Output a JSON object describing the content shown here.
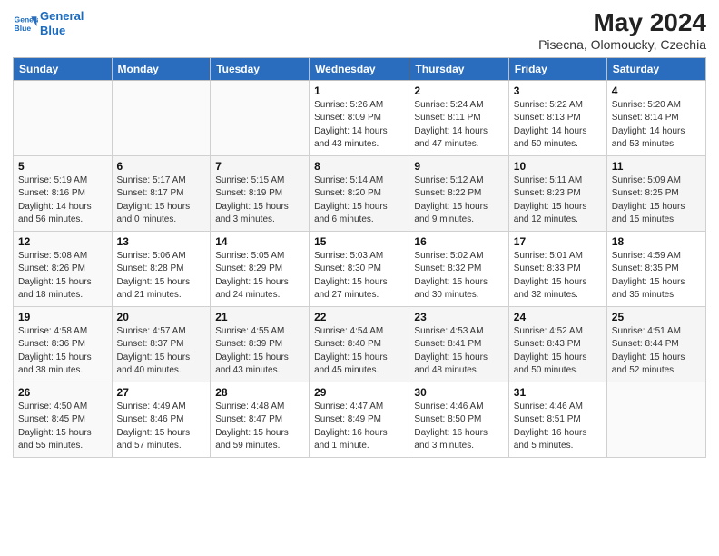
{
  "header": {
    "logo_line1": "General",
    "logo_line2": "Blue",
    "title": "May 2024",
    "subtitle": "Pisecna, Olomoucky, Czechia"
  },
  "days_of_week": [
    "Sunday",
    "Monday",
    "Tuesday",
    "Wednesday",
    "Thursday",
    "Friday",
    "Saturday"
  ],
  "weeks": [
    [
      {
        "day": "",
        "info": ""
      },
      {
        "day": "",
        "info": ""
      },
      {
        "day": "",
        "info": ""
      },
      {
        "day": "1",
        "info": "Sunrise: 5:26 AM\nSunset: 8:09 PM\nDaylight: 14 hours and 43 minutes."
      },
      {
        "day": "2",
        "info": "Sunrise: 5:24 AM\nSunset: 8:11 PM\nDaylight: 14 hours and 47 minutes."
      },
      {
        "day": "3",
        "info": "Sunrise: 5:22 AM\nSunset: 8:13 PM\nDaylight: 14 hours and 50 minutes."
      },
      {
        "day": "4",
        "info": "Sunrise: 5:20 AM\nSunset: 8:14 PM\nDaylight: 14 hours and 53 minutes."
      }
    ],
    [
      {
        "day": "5",
        "info": "Sunrise: 5:19 AM\nSunset: 8:16 PM\nDaylight: 14 hours and 56 minutes."
      },
      {
        "day": "6",
        "info": "Sunrise: 5:17 AM\nSunset: 8:17 PM\nDaylight: 15 hours and 0 minutes."
      },
      {
        "day": "7",
        "info": "Sunrise: 5:15 AM\nSunset: 8:19 PM\nDaylight: 15 hours and 3 minutes."
      },
      {
        "day": "8",
        "info": "Sunrise: 5:14 AM\nSunset: 8:20 PM\nDaylight: 15 hours and 6 minutes."
      },
      {
        "day": "9",
        "info": "Sunrise: 5:12 AM\nSunset: 8:22 PM\nDaylight: 15 hours and 9 minutes."
      },
      {
        "day": "10",
        "info": "Sunrise: 5:11 AM\nSunset: 8:23 PM\nDaylight: 15 hours and 12 minutes."
      },
      {
        "day": "11",
        "info": "Sunrise: 5:09 AM\nSunset: 8:25 PM\nDaylight: 15 hours and 15 minutes."
      }
    ],
    [
      {
        "day": "12",
        "info": "Sunrise: 5:08 AM\nSunset: 8:26 PM\nDaylight: 15 hours and 18 minutes."
      },
      {
        "day": "13",
        "info": "Sunrise: 5:06 AM\nSunset: 8:28 PM\nDaylight: 15 hours and 21 minutes."
      },
      {
        "day": "14",
        "info": "Sunrise: 5:05 AM\nSunset: 8:29 PM\nDaylight: 15 hours and 24 minutes."
      },
      {
        "day": "15",
        "info": "Sunrise: 5:03 AM\nSunset: 8:30 PM\nDaylight: 15 hours and 27 minutes."
      },
      {
        "day": "16",
        "info": "Sunrise: 5:02 AM\nSunset: 8:32 PM\nDaylight: 15 hours and 30 minutes."
      },
      {
        "day": "17",
        "info": "Sunrise: 5:01 AM\nSunset: 8:33 PM\nDaylight: 15 hours and 32 minutes."
      },
      {
        "day": "18",
        "info": "Sunrise: 4:59 AM\nSunset: 8:35 PM\nDaylight: 15 hours and 35 minutes."
      }
    ],
    [
      {
        "day": "19",
        "info": "Sunrise: 4:58 AM\nSunset: 8:36 PM\nDaylight: 15 hours and 38 minutes."
      },
      {
        "day": "20",
        "info": "Sunrise: 4:57 AM\nSunset: 8:37 PM\nDaylight: 15 hours and 40 minutes."
      },
      {
        "day": "21",
        "info": "Sunrise: 4:55 AM\nSunset: 8:39 PM\nDaylight: 15 hours and 43 minutes."
      },
      {
        "day": "22",
        "info": "Sunrise: 4:54 AM\nSunset: 8:40 PM\nDaylight: 15 hours and 45 minutes."
      },
      {
        "day": "23",
        "info": "Sunrise: 4:53 AM\nSunset: 8:41 PM\nDaylight: 15 hours and 48 minutes."
      },
      {
        "day": "24",
        "info": "Sunrise: 4:52 AM\nSunset: 8:43 PM\nDaylight: 15 hours and 50 minutes."
      },
      {
        "day": "25",
        "info": "Sunrise: 4:51 AM\nSunset: 8:44 PM\nDaylight: 15 hours and 52 minutes."
      }
    ],
    [
      {
        "day": "26",
        "info": "Sunrise: 4:50 AM\nSunset: 8:45 PM\nDaylight: 15 hours and 55 minutes."
      },
      {
        "day": "27",
        "info": "Sunrise: 4:49 AM\nSunset: 8:46 PM\nDaylight: 15 hours and 57 minutes."
      },
      {
        "day": "28",
        "info": "Sunrise: 4:48 AM\nSunset: 8:47 PM\nDaylight: 15 hours and 59 minutes."
      },
      {
        "day": "29",
        "info": "Sunrise: 4:47 AM\nSunset: 8:49 PM\nDaylight: 16 hours and 1 minute."
      },
      {
        "day": "30",
        "info": "Sunrise: 4:46 AM\nSunset: 8:50 PM\nDaylight: 16 hours and 3 minutes."
      },
      {
        "day": "31",
        "info": "Sunrise: 4:46 AM\nSunset: 8:51 PM\nDaylight: 16 hours and 5 minutes."
      },
      {
        "day": "",
        "info": ""
      }
    ]
  ]
}
